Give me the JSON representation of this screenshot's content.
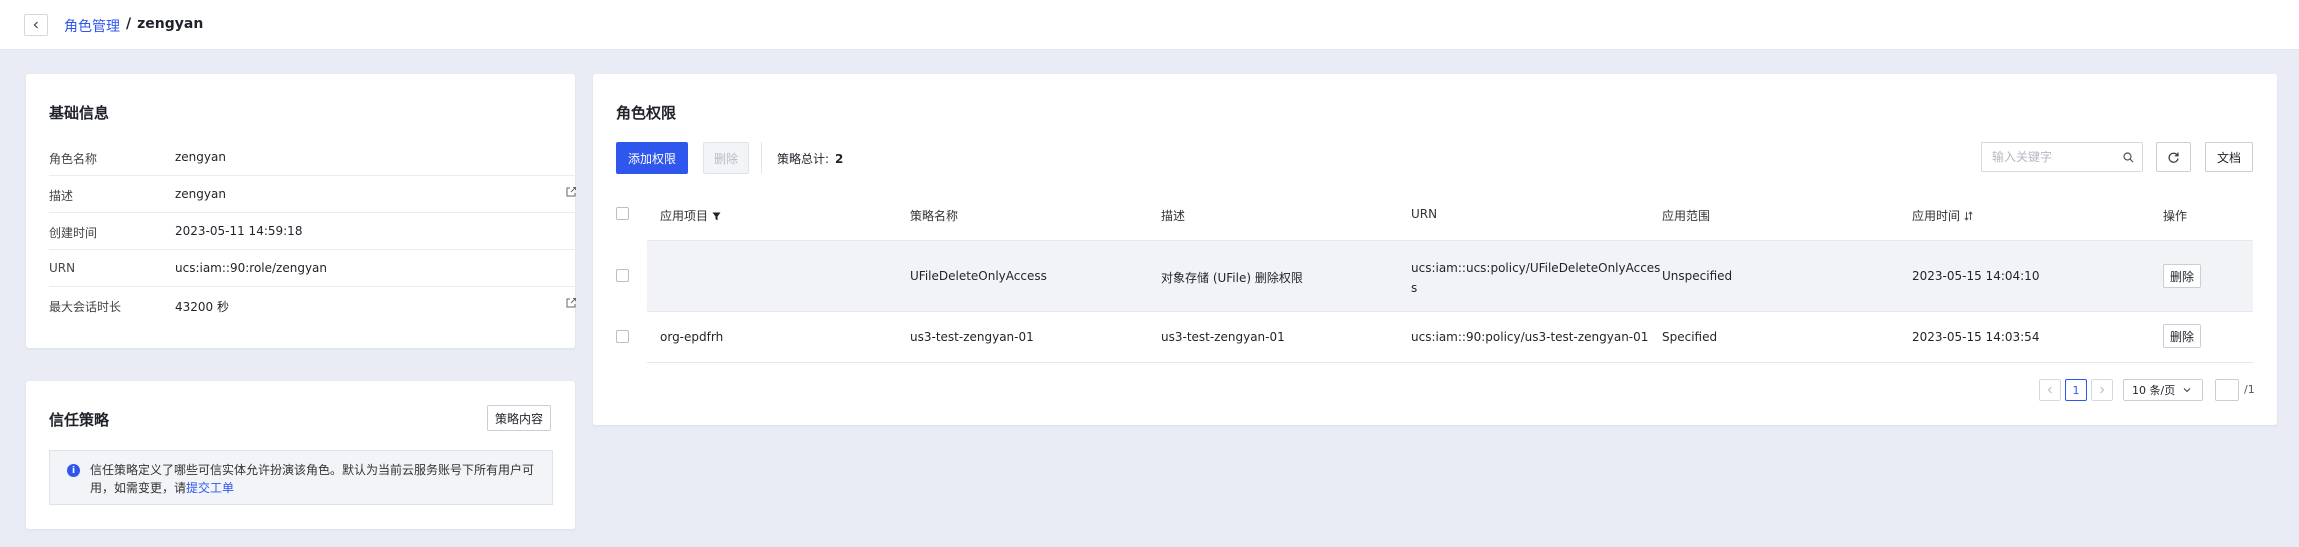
{
  "header": {
    "back_icon": "chevron-left-icon",
    "breadcrumb_parent": "角色管理",
    "breadcrumb_sep": "/",
    "breadcrumb_current": "zengyan"
  },
  "basic_info": {
    "title": "基础信息",
    "rows": [
      {
        "label": "角色名称",
        "value": "zengyan",
        "editable": false
      },
      {
        "label": "描述",
        "value": "zengyan",
        "editable": true
      },
      {
        "label": "创建时间",
        "value": "2023-05-11 14:59:18",
        "editable": false
      },
      {
        "label": "URN",
        "value": "ucs:iam::90:role/zengyan",
        "editable": false
      },
      {
        "label": "最大会话时长",
        "value": "43200 秒",
        "editable": true
      }
    ]
  },
  "trust_policy": {
    "title": "信任策略",
    "content_button": "策略内容",
    "notice_text": "信任策略定义了哪些可信实体允许扮演该角色。默认为当前云服务账号下所有用户可用，如需变更，请",
    "notice_link": "提交工单"
  },
  "permissions": {
    "title": "角色权限",
    "add_button": "添加权限",
    "delete_button": "删除",
    "total_label": "策略总计:",
    "total_count": "2",
    "search_placeholder": "输入关键字",
    "doc_button": "文档",
    "columns": {
      "project": "应用项目",
      "policy_name": "策略名称",
      "description": "描述",
      "urn": "URN",
      "scope": "应用范围",
      "applied_time": "应用时间",
      "actions": "操作"
    },
    "rows": [
      {
        "project": "",
        "policy_name": "UFileDeleteOnlyAccess",
        "description": "对象存储 (UFile) 删除权限",
        "urn_line1": "ucs:iam::ucs:policy/UFileDeleteOnlyAcces",
        "urn_line2": "s",
        "scope": "Unspecified",
        "applied_time": "2023-05-15 14:04:10",
        "action": "删除"
      },
      {
        "project": "org-epdfrh",
        "policy_name": "us3-test-zengyan-01",
        "description": "us3-test-zengyan-01",
        "urn_line1": "ucs:iam::90:policy/us3-test-zengyan-01",
        "urn_line2": "",
        "scope": "Specified",
        "applied_time": "2023-05-15 14:03:54",
        "action": "删除"
      }
    ],
    "pagination": {
      "current_page": "1",
      "page_size": "10 条/页",
      "total_pages": "/1"
    }
  },
  "colors": {
    "accent": "#2f57ed",
    "background": "#e9ecf4",
    "row_highlight": "#f1f3f7"
  }
}
